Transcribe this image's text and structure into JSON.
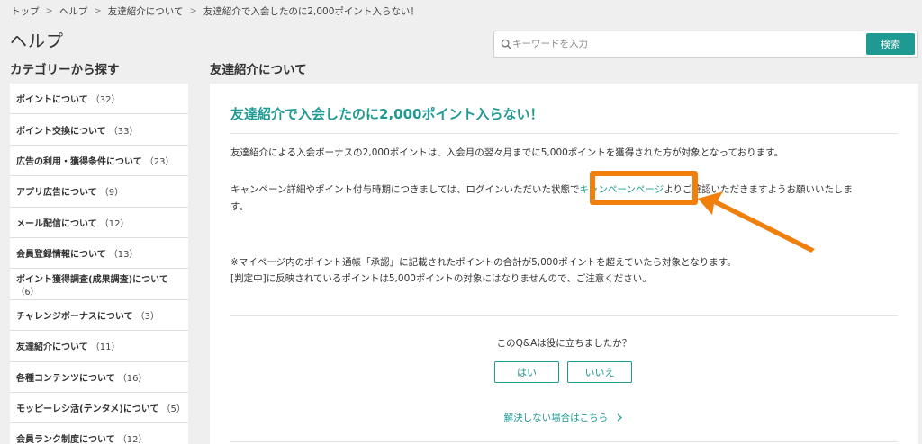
{
  "breadcrumb": {
    "items": [
      "トップ",
      "ヘルプ",
      "友達紹介について",
      "友達紹介で入会したのに2,000ポイント入らない！"
    ],
    "separator": ">"
  },
  "page_title": "ヘルプ",
  "search": {
    "placeholder": "キーワードを入力",
    "value": "",
    "button_label": "検索"
  },
  "sidebar": {
    "heading": "カテゴリーから探す",
    "items": [
      {
        "label": "ポイントについて",
        "count": "（32）"
      },
      {
        "label": "ポイント交換について",
        "count": "（33）"
      },
      {
        "label": "広告の利用・獲得条件について",
        "count": "（23）"
      },
      {
        "label": "アプリ広告について",
        "count": "（9）"
      },
      {
        "label": "メール配信について",
        "count": "（12）"
      },
      {
        "label": "会員登録情報について",
        "count": "（13）"
      },
      {
        "label": "ポイント獲得調査(成果調査)について",
        "count": "（6）"
      },
      {
        "label": "チャレンジボーナスについて",
        "count": "（3）"
      },
      {
        "label": "友達紹介について",
        "count": "（11）"
      },
      {
        "label": "各種コンテンツについて",
        "count": "（16）"
      },
      {
        "label": "モッピーレシ活(テンタメ)について",
        "count": "（5）"
      },
      {
        "label": "会員ランク制度について",
        "count": "（12）"
      }
    ]
  },
  "main": {
    "heading": "友達紹介について",
    "article_title": "友達紹介で入会したのに2,000ポイント入らない！",
    "paragraph1": "友達紹介による入会ボーナスの2,000ポイントは、入会月の翌々月までに5,000ポイントを獲得された方が対象となっております。",
    "paragraph2_before": "キャンペーン詳細やポイント付与時期につきましては、ログインいただいた状態で",
    "paragraph2_link": "キャンペーンページ",
    "paragraph2_after": "よりご確認いただきますようお願いいたしま",
    "paragraph2_cont": "す。",
    "note1": "※マイページ内のポイント通帳「承認」に記載されたポイントの合計が5,000ポイントを超えていたら対象となります。",
    "note2": "[判定中]に反映されているポイントは5,000ポイントの対象にはなりませんので、ご注意ください。",
    "feedback_question": "このQ&Aは役に立ちましたか？",
    "yes_label": "はい",
    "no_label": "いいえ",
    "unresolved_link": "解決しない場合はこちら"
  },
  "colors": {
    "accent": "#1f9a92",
    "highlight": "#f07f0d",
    "background": "#efefef"
  },
  "icons": [
    "search-icon",
    "chevron-right-icon",
    "arrow-annotation-icon"
  ]
}
